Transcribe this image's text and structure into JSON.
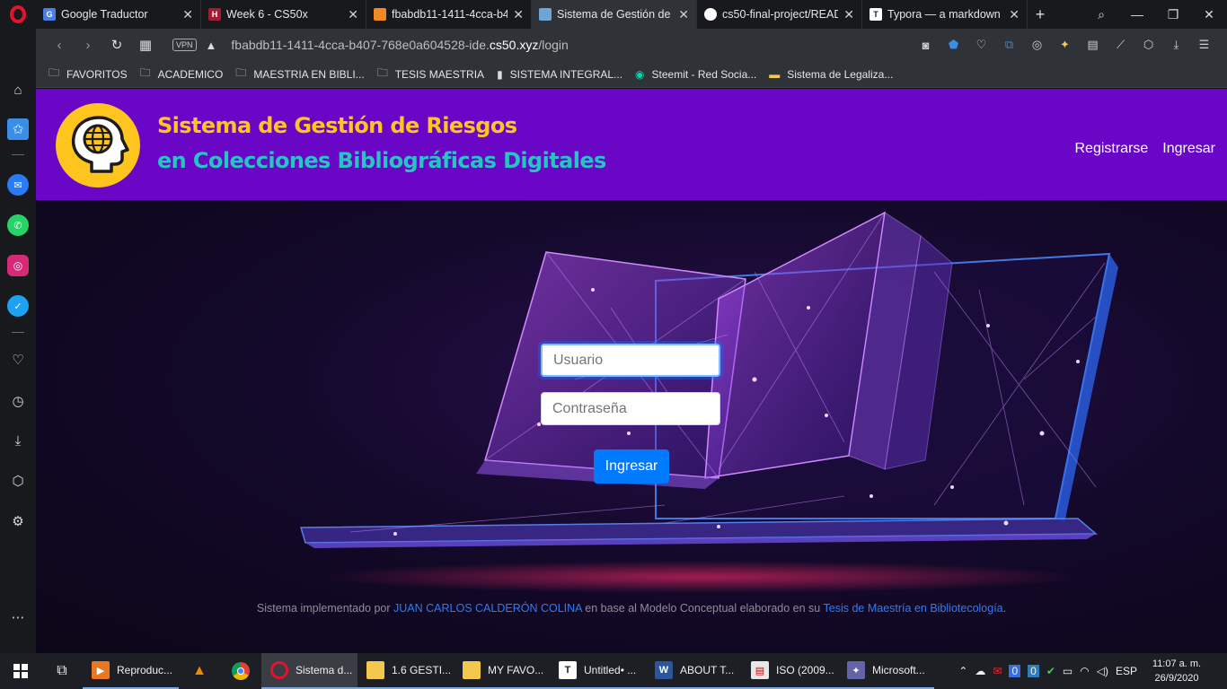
{
  "tabs": [
    {
      "title": "Google Traductor",
      "fav": "G",
      "fav_color": "#4a7ee8"
    },
    {
      "title": "Week 6 - CS50x",
      "fav": "H",
      "fav_color": "#a51c30"
    },
    {
      "title": "fbabdb11-1411-4cca-b4(",
      "fav": "",
      "fav_color": "#f28a22"
    },
    {
      "title": "Sistema de Gestión de R",
      "fav": "",
      "fav_color": "#6aa6d6"
    },
    {
      "title": "cs50-final-project/READ",
      "fav": "",
      "fav_color": "#ffffff"
    },
    {
      "title": "Typora — a markdown e",
      "fav": "T",
      "fav_color": "#ffffff"
    }
  ],
  "address": {
    "vpn": "VPN",
    "url_prefix": "fbabdb11-1411-4cca-b407-768e0a604528-ide.",
    "url_domain": "cs50.xyz",
    "url_path": "/login"
  },
  "bookmarks": [
    {
      "label": "FAVORITOS",
      "icon": "folder-icon"
    },
    {
      "label": "ACADEMICO",
      "icon": "folder-icon"
    },
    {
      "label": "MAESTRIA EN BIBLI...",
      "icon": "folder-icon"
    },
    {
      "label": "TESIS MAESTRIA",
      "icon": "folder-icon"
    },
    {
      "label": "SISTEMA INTEGRAL...",
      "icon": "file-icon"
    },
    {
      "label": "Steemit - Red Socia...",
      "icon": "steemit-icon"
    },
    {
      "label": "Sistema de Legaliza...",
      "icon": "flag-icon"
    }
  ],
  "site": {
    "brand_line1": "Sistema de Gestión de Riesgos",
    "brand_line2": "en Colecciones Bibliográficas Digitales",
    "nav_register": "Registrarse",
    "nav_login": "Ingresar",
    "colors": {
      "header": "#6a07c7",
      "brand1": "#ffc51e",
      "brand2": "#27c4c4",
      "button": "#007bff"
    }
  },
  "login_form": {
    "username_placeholder": "Usuario",
    "password_placeholder": "Contraseña",
    "submit_label": "Ingresar"
  },
  "footer": {
    "text1": "Sistema implementado por ",
    "author": "JUAN CARLOS CALDERÓN COLINA",
    "text2": " en base al Modelo Conceptual elaborado en su ",
    "thesis": "Tesis de Maestría en Bibliotecología",
    "text3": "."
  },
  "taskbar": {
    "apps": [
      {
        "label": "Reproduc...",
        "icon": "media-player-icon",
        "color": "#e87722"
      },
      {
        "label": "Sistema d...",
        "icon": "opera-icon",
        "color": "#e4122c",
        "active": true
      },
      {
        "label": "1.6 GESTI...",
        "icon": "folder-icon",
        "color": "#f2c94c"
      },
      {
        "label": "MY FAVO...",
        "icon": "folder-icon",
        "color": "#f2c94c"
      },
      {
        "label": "Untitled• ...",
        "icon": "typora-icon",
        "color": "#ffffff"
      },
      {
        "label": "ABOUT T...",
        "icon": "word-icon",
        "color": "#2b579a"
      },
      {
        "label": "ISO (2009...",
        "icon": "pdf-icon",
        "color": "#e8e8e8"
      },
      {
        "label": "Microsoft...",
        "icon": "teams-icon",
        "color": "#6264a7"
      }
    ],
    "language": "ESP",
    "time": "11:07 a. m.",
    "date": "26/9/2020"
  }
}
